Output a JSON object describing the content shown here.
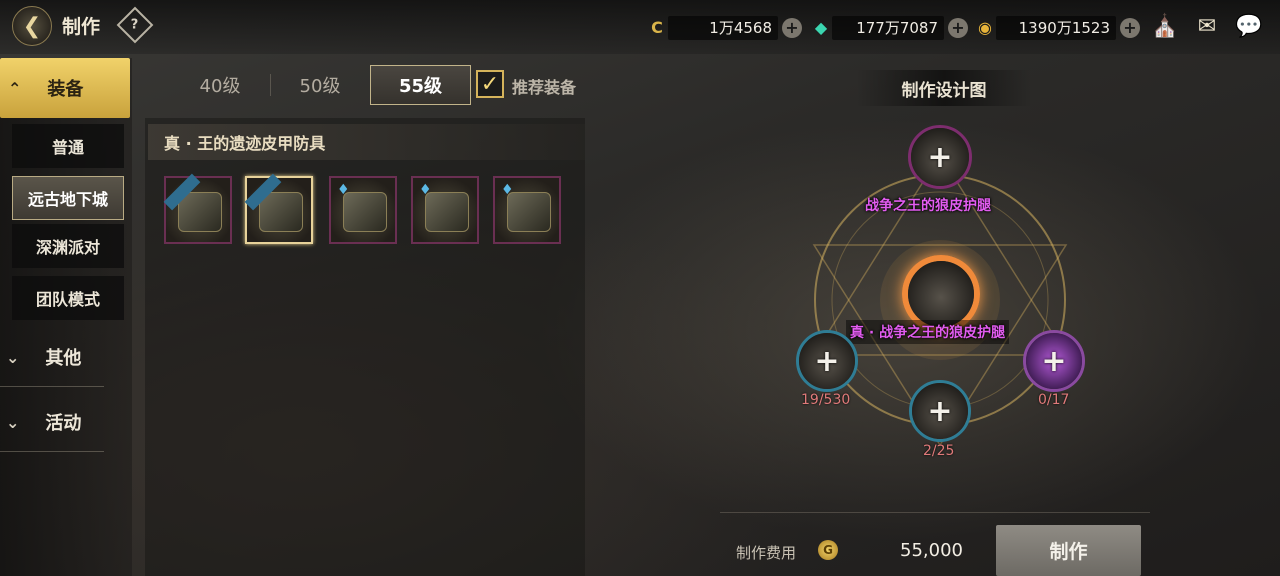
{
  "header": {
    "title": "制作",
    "back_icon": "back-arrow-icon",
    "help_icon": "question-icon"
  },
  "currencies": [
    {
      "name": "stamina-currency",
      "value": "1万4568",
      "icon": "c-coin-icon",
      "color": "#d9b44a"
    },
    {
      "name": "gem-currency",
      "value": "177万7087",
      "icon": "green-gem-icon",
      "color": "#3bd6b0"
    },
    {
      "name": "gold-currency",
      "value": "1390万1523",
      "icon": "gold-coin-icon",
      "color": "#e7b43a"
    }
  ],
  "top_icons": [
    "treasure-chest-icon",
    "mail-icon",
    "chat-icon"
  ],
  "sidebar": {
    "active_category": "装备",
    "sub_items": [
      {
        "label": "普通",
        "selected": false
      },
      {
        "label": "远古地下城",
        "selected": true
      },
      {
        "label": "深渊派对",
        "selected": false
      },
      {
        "label": "团队模式",
        "selected": false
      }
    ],
    "categories": [
      {
        "label": "其他"
      },
      {
        "label": "活动"
      }
    ]
  },
  "tabs": [
    {
      "label": "40级",
      "active": false
    },
    {
      "label": "50级",
      "active": false
    },
    {
      "label": "55级",
      "active": true
    }
  ],
  "recommend": {
    "label": "推荐装备",
    "checked": true
  },
  "item_set": {
    "title": "真 · 王的遗迹皮甲防具",
    "slots": [
      {
        "icon": "armor-icon",
        "owned_ribbon": true,
        "selected": false
      },
      {
        "icon": "leg-armor-icon",
        "owned_ribbon": true,
        "selected": true
      },
      {
        "icon": "shoulder-armor-icon",
        "owned_ribbon": false,
        "selected": false
      },
      {
        "icon": "belt-icon",
        "owned_ribbon": false,
        "selected": false
      },
      {
        "icon": "boots-icon",
        "owned_ribbon": false,
        "selected": false
      }
    ]
  },
  "design": {
    "title": "制作设计图",
    "top_node_name": "战争之王的狼皮护腿",
    "center_node_name": "真 · 战争之王的狼皮护腿",
    "materials": [
      {
        "count": "19/530"
      },
      {
        "count": "2/25"
      },
      {
        "count": "0/17"
      }
    ]
  },
  "footer": {
    "cost_label": "制作费用",
    "cost_value": "55,000",
    "craft_button": "制作"
  }
}
